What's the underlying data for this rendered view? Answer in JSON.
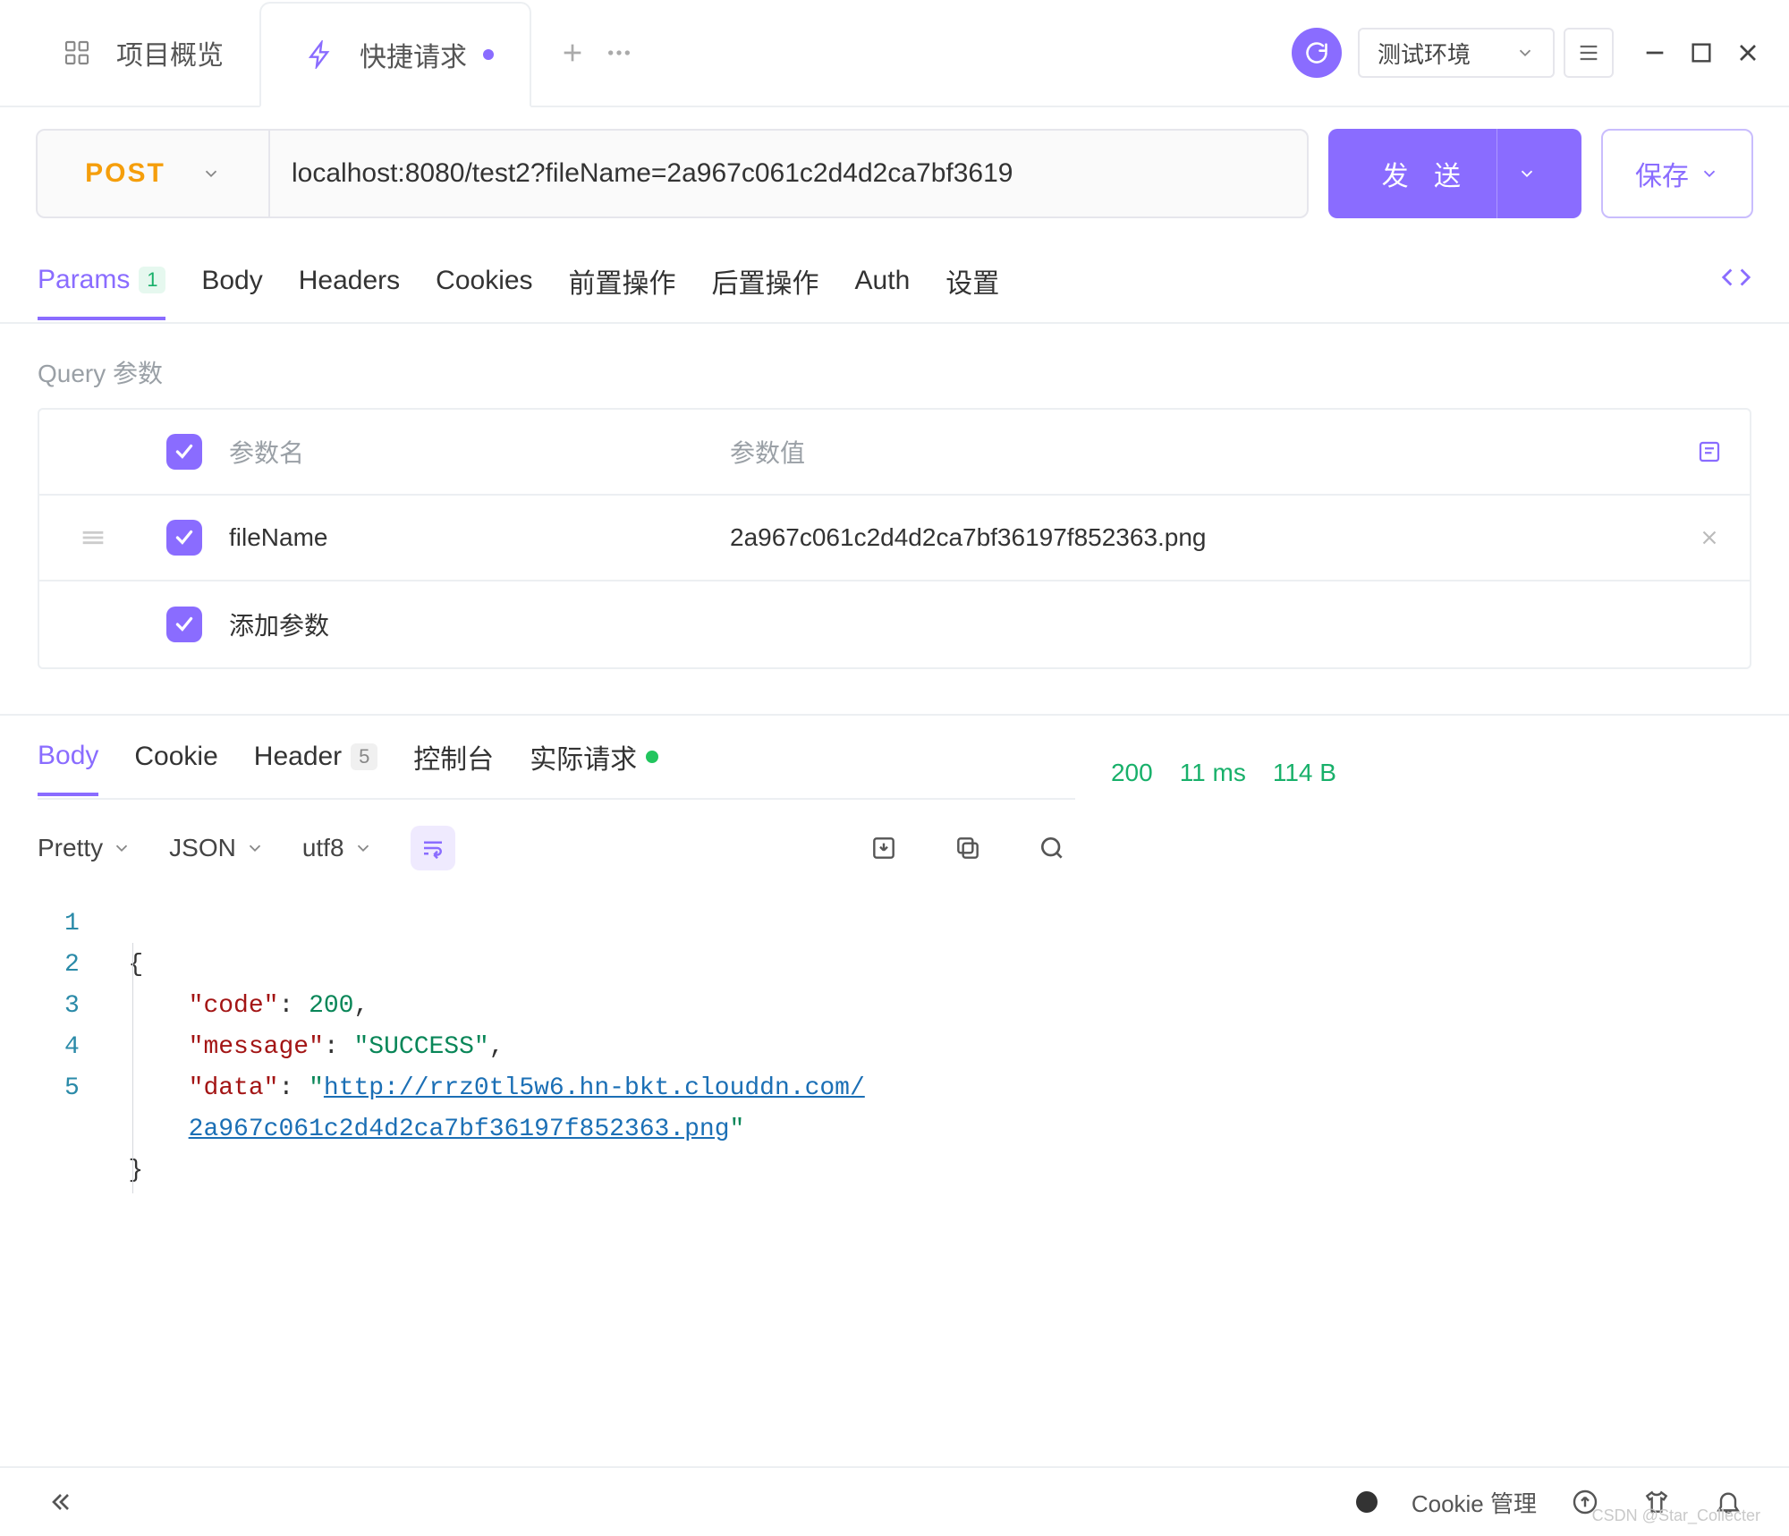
{
  "tabs": {
    "overview": {
      "label": "项目概览"
    },
    "quick": {
      "label": "快捷请求",
      "icon": "lightning-icon"
    }
  },
  "env": {
    "selected": "测试环境"
  },
  "request": {
    "method": "POST",
    "url": "localhost:8080/test2?fileName=2a967c061c2d4d2ca7bf3619",
    "send_label": "发 送",
    "save_label": "保存"
  },
  "request_tabs": {
    "params": {
      "label": "Params",
      "count": "1"
    },
    "body": {
      "label": "Body"
    },
    "headers": {
      "label": "Headers"
    },
    "cookies": {
      "label": "Cookies"
    },
    "pre": {
      "label": "前置操作"
    },
    "post": {
      "label": "后置操作"
    },
    "auth": {
      "label": "Auth"
    },
    "settings": {
      "label": "设置"
    }
  },
  "params": {
    "section_label": "Query 参数",
    "header": {
      "name": "参数名",
      "value": "参数值"
    },
    "rows": [
      {
        "checked": true,
        "name": "fileName",
        "value": "2a967c061c2d4d2ca7bf36197f852363.png"
      }
    ],
    "add_placeholder": "添加参数"
  },
  "response_tabs": {
    "body": {
      "label": "Body"
    },
    "cookie": {
      "label": "Cookie"
    },
    "header": {
      "label": "Header",
      "count": "5"
    },
    "console": {
      "label": "控制台"
    },
    "actual": {
      "label": "实际请求"
    }
  },
  "response_toolbar": {
    "pretty": "Pretty",
    "json": "JSON",
    "encoding": "utf8"
  },
  "response_status": {
    "code": "200",
    "time": "11 ms",
    "size": "114 B"
  },
  "response_body": {
    "code_key": "\"code\"",
    "code_val": "200",
    "msg_key": "\"message\"",
    "msg_val": "\"SUCCESS\"",
    "data_key": "\"data\"",
    "data_val_prefix": "\"",
    "data_url_line1": "http://rrz0tl5w6.hn-bkt.clouddn.com/",
    "data_url_line2": "2a967c061c2d4d2ca7bf36197f852363.png",
    "data_val_suffix": "\""
  },
  "gutter": [
    "1",
    "2",
    "3",
    "4",
    "",
    "5"
  ],
  "footer": {
    "cookie": "Cookie 管理",
    "watermark": "CSDN @Star_Collecter"
  }
}
